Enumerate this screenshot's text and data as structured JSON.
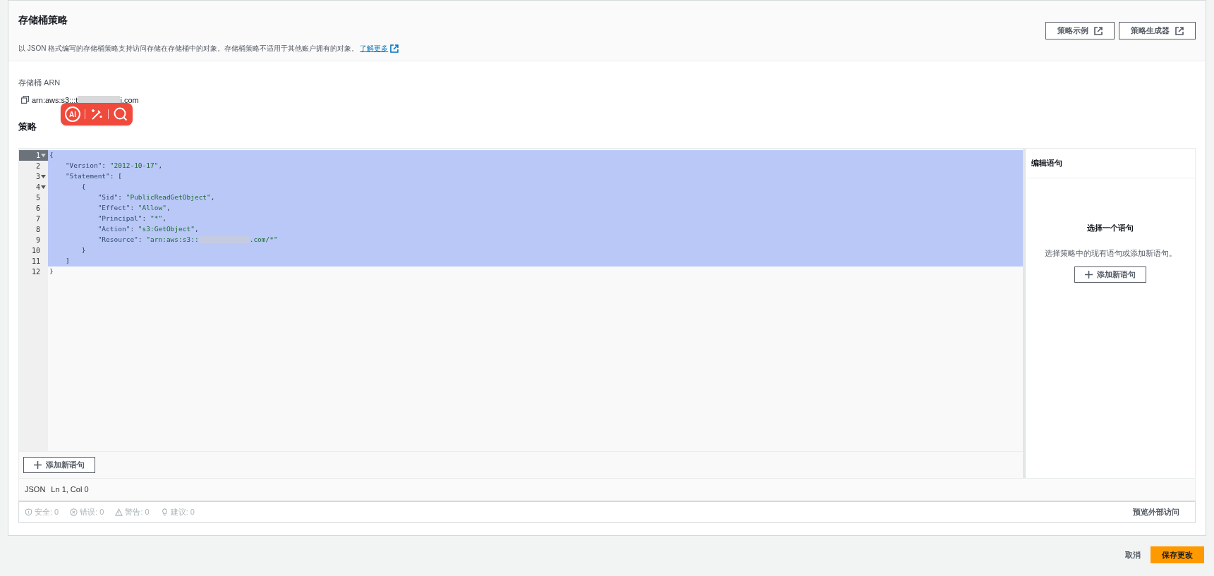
{
  "header": {
    "title": "存储桶策略",
    "description": "以 JSON 格式编写的存储桶策略支持访问存储在存储桶中的对象。存储桶策略不适用于其他账户拥有的对象。",
    "link": "了解更多",
    "buttons": [
      "策略示例",
      "策略生成器"
    ]
  },
  "arn": {
    "label": "存储桶 ARN",
    "prefix": "arn:aws:s3:::t",
    "suffix": "i.com"
  },
  "toolbar_overlay": {
    "ai_label": "AI"
  },
  "policy": {
    "title": "策略",
    "lines": [
      {
        "number": "1",
        "fold": true,
        "active": true,
        "selected": true,
        "tokens": [
          {
            "kind": "punct",
            "text": "{"
          }
        ]
      },
      {
        "number": "2",
        "fold": false,
        "active": false,
        "selected": true,
        "tokens": [
          {
            "kind": "key",
            "text": "    \"Version\""
          },
          {
            "kind": "punct",
            "text": ": "
          },
          {
            "kind": "string",
            "text": "\"2012-10-17\""
          },
          {
            "kind": "punct",
            "text": ","
          }
        ]
      },
      {
        "number": "3",
        "fold": true,
        "active": false,
        "selected": true,
        "tokens": [
          {
            "kind": "key",
            "text": "    \"Statement\""
          },
          {
            "kind": "punct",
            "text": ": ["
          }
        ]
      },
      {
        "number": "4",
        "fold": true,
        "active": false,
        "selected": true,
        "tokens": [
          {
            "kind": "punct",
            "text": "        {"
          }
        ]
      },
      {
        "number": "5",
        "fold": false,
        "active": false,
        "selected": true,
        "tokens": [
          {
            "kind": "key",
            "text": "            \"Sid\""
          },
          {
            "kind": "punct",
            "text": ": "
          },
          {
            "kind": "string",
            "text": "\"PublicReadGetObject\""
          },
          {
            "kind": "punct",
            "text": ","
          }
        ]
      },
      {
        "number": "6",
        "fold": false,
        "active": false,
        "selected": true,
        "tokens": [
          {
            "kind": "key",
            "text": "            \"Effect\""
          },
          {
            "kind": "punct",
            "text": ": "
          },
          {
            "kind": "string",
            "text": "\"Allow\""
          },
          {
            "kind": "punct",
            "text": ","
          }
        ]
      },
      {
        "number": "7",
        "fold": false,
        "active": false,
        "selected": true,
        "tokens": [
          {
            "kind": "key",
            "text": "            \"Principal\""
          },
          {
            "kind": "punct",
            "text": ": "
          },
          {
            "kind": "string",
            "text": "\"*\""
          },
          {
            "kind": "punct",
            "text": ","
          }
        ]
      },
      {
        "number": "8",
        "fold": false,
        "active": false,
        "selected": true,
        "tokens": [
          {
            "kind": "key",
            "text": "            \"Action\""
          },
          {
            "kind": "punct",
            "text": ": "
          },
          {
            "kind": "string",
            "text": "\"s3:GetObject\""
          },
          {
            "kind": "punct",
            "text": ","
          }
        ]
      },
      {
        "number": "9",
        "fold": false,
        "active": false,
        "selected": true,
        "tokens": [
          {
            "kind": "key",
            "text": "            \"Resource\""
          },
          {
            "kind": "punct",
            "text": ": "
          },
          {
            "kind": "string",
            "text": "\"arn:aws:s3::"
          },
          {
            "kind": "redacted"
          },
          {
            "kind": "string",
            "text": ".com/*\""
          }
        ]
      },
      {
        "number": "10",
        "fold": false,
        "active": false,
        "selected": true,
        "tokens": [
          {
            "kind": "punct",
            "text": "        }"
          }
        ]
      },
      {
        "number": "11",
        "fold": false,
        "active": false,
        "selected": true,
        "tokens": [
          {
            "kind": "punct",
            "text": "    ]"
          }
        ]
      },
      {
        "number": "12",
        "fold": false,
        "active": false,
        "selected": false,
        "tokens": [
          {
            "kind": "punct",
            "text": "}"
          }
        ]
      }
    ],
    "add_button": "添加新语句",
    "status": {
      "mode": "JSON",
      "position": "Ln 1, Col 0"
    },
    "issues": [
      {
        "kind": "security",
        "label": "安全: 0"
      },
      {
        "kind": "error",
        "label": "错误: 0"
      },
      {
        "kind": "warning",
        "label": "警告: 0"
      },
      {
        "kind": "suggestion",
        "label": "建议: 0"
      }
    ],
    "preview_link": "预览外部访问"
  },
  "side_panel": {
    "title": "编辑语句",
    "heading": "选择一个语句",
    "text": "选择策略中的现有语句或添加新语句。",
    "button": "添加新语句"
  },
  "footer": {
    "cancel": "取消",
    "save": "保存更改"
  }
}
